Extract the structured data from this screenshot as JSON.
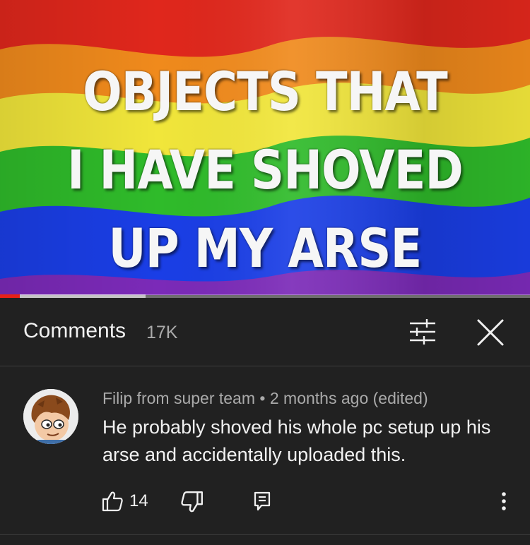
{
  "video": {
    "title_lines": [
      "OBJECTS THAT",
      "I HAVE SHOVED",
      "UP MY ARSE"
    ],
    "progress_fraction": 0.27,
    "colors": {
      "red": "#e0271c",
      "orange": "#f08a1c",
      "yellow": "#f1e63a",
      "green": "#2fbb2a",
      "blue": "#1a3ee6",
      "violet": "#7b2ab8",
      "progress": "#e62117"
    }
  },
  "comments_panel": {
    "title": "Comments",
    "count": "17K",
    "filter_icon": "sliders-icon",
    "close_icon": "close-icon"
  },
  "comment": {
    "author": "Filip from super team",
    "separator": "•",
    "time": "2 months ago (edited)",
    "text": "He probably shoved his whole pc setup up his arse and accidentally uploaded this.",
    "likes": "14",
    "icons": [
      "thumbs-up-icon",
      "thumbs-down-icon",
      "reply-icon",
      "more-vertical-icon"
    ]
  }
}
